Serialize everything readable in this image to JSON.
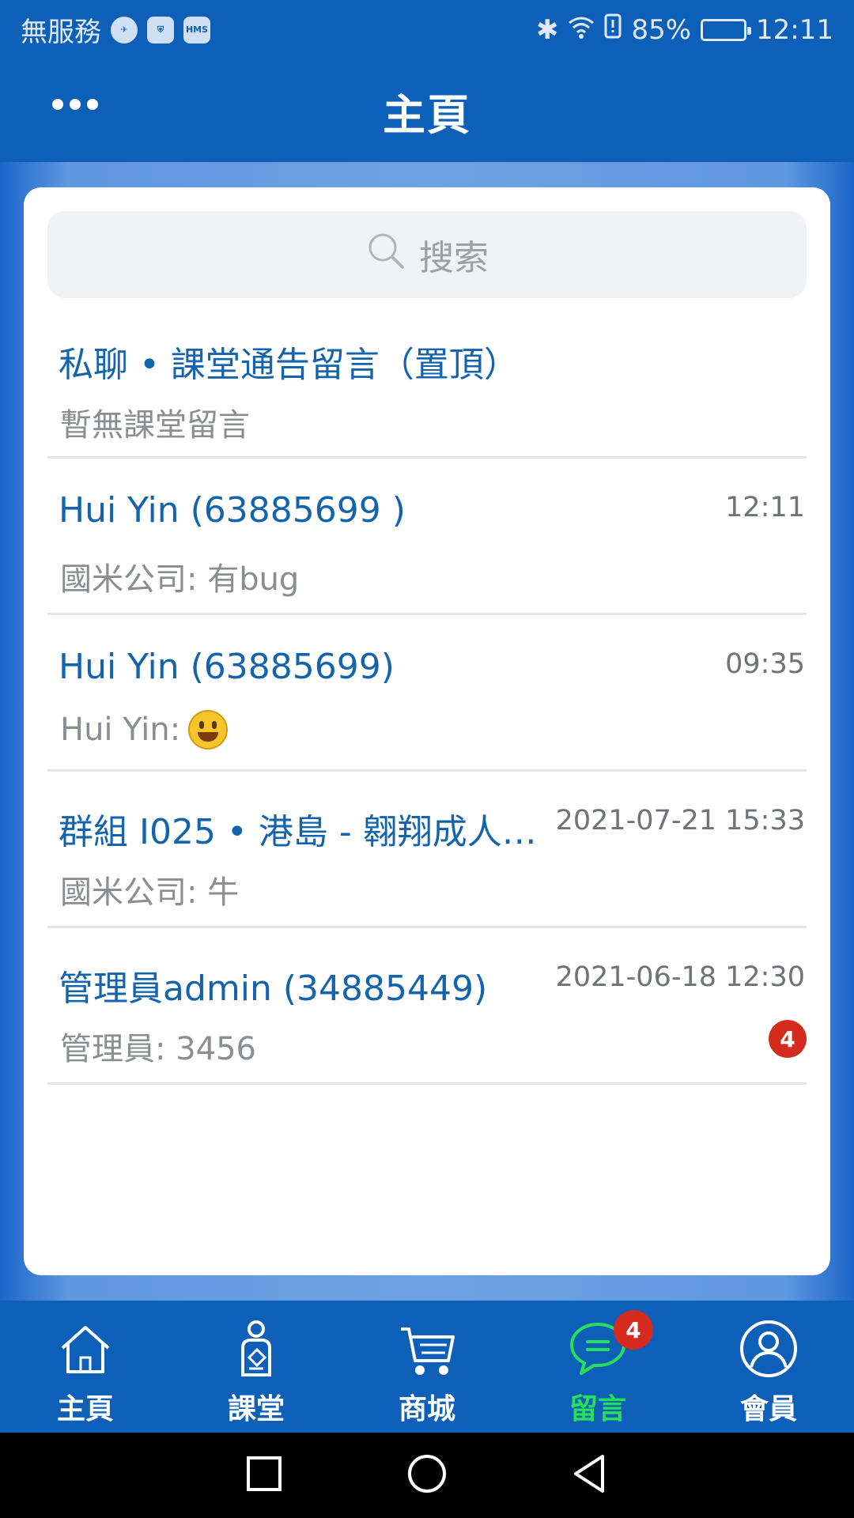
{
  "status_bar": {
    "carrier": "無服務",
    "battery": "85%",
    "time": "12:11",
    "battery_level": 0.85,
    "hms_label": "HMS"
  },
  "header": {
    "title": "主頁"
  },
  "search": {
    "placeholder": "搜索"
  },
  "conversations": [
    {
      "title": "私聊 • 課堂通告留言（置頂）",
      "preview": "暫無課堂留言",
      "time": ""
    },
    {
      "title": "Hui Yin (63885699 )",
      "preview": "國米公司: 有bug",
      "time": "12:11"
    },
    {
      "title": "Hui Yin (63885699)",
      "preview": "Hui Yin:",
      "time": "09:35",
      "emoji": "smiley-icon"
    },
    {
      "title": "群組 I025 • 港島 - 翱翔成人足球…",
      "preview": "國米公司: 牛",
      "time": "2021-07-21 15:33"
    },
    {
      "title": "管理員admin (34885449)",
      "preview": "管理員: 3456",
      "time": "2021-06-18 12:30",
      "unread": "4"
    }
  ],
  "bottom_nav": {
    "items": [
      {
        "label": "主頁",
        "icon": "home-icon"
      },
      {
        "label": "課堂",
        "icon": "classroom-icon"
      },
      {
        "label": "商城",
        "icon": "cart-icon"
      },
      {
        "label": "留言",
        "icon": "chat-icon",
        "badge": "4",
        "active": true
      },
      {
        "label": "會員",
        "icon": "user-icon"
      }
    ]
  },
  "colors": {
    "brand": "#0d5fb8",
    "active": "#27e05a",
    "badge": "#d52b1e",
    "link": "#1364ad"
  }
}
